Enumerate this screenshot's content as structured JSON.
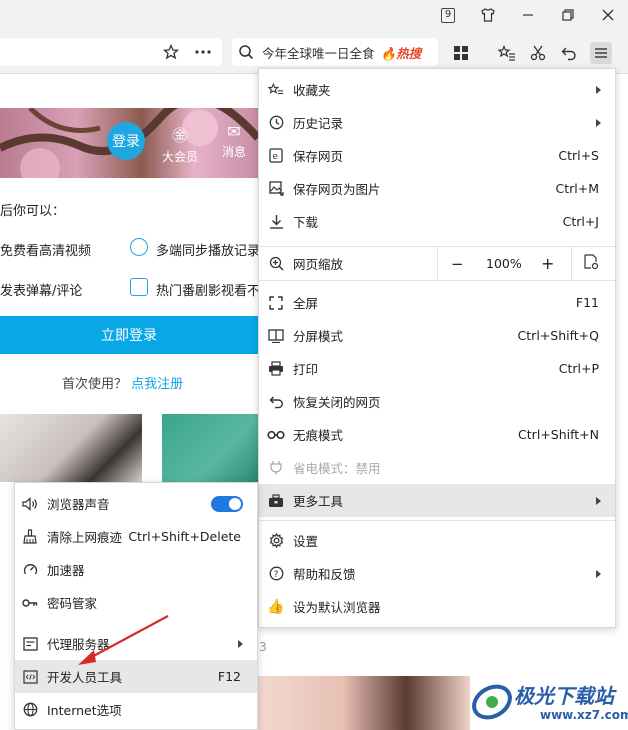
{
  "titlebar": {
    "badge_number": "9"
  },
  "toolbar": {
    "search_text": "今年全球唯一日全食",
    "hot_label": "热搜"
  },
  "page": {
    "login_circle": "登录",
    "vip_label": "大会员",
    "msg_label": "消息",
    "after_login": "后你可以：",
    "feature1": "免费看高清视频",
    "feature2": "多端同步播放记录",
    "feature3": "发表弹幕/评论",
    "feature4": "热门番剧影视看不",
    "login_button": "立即登录",
    "first_use": "首次使用？",
    "register_link": "点我注册",
    "page_num": "3"
  },
  "menu": {
    "items": [
      {
        "label": "收藏夹",
        "shortcut": ""
      },
      {
        "label": "历史记录",
        "shortcut": ""
      },
      {
        "label": "保存网页",
        "shortcut": "Ctrl+S"
      },
      {
        "label": "保存网页为图片",
        "shortcut": "Ctrl+M"
      },
      {
        "label": "下载",
        "shortcut": "Ctrl+J"
      },
      {
        "label": "网页缩放",
        "shortcut": ""
      },
      {
        "label": "全屏",
        "shortcut": "F11"
      },
      {
        "label": "分屏模式",
        "shortcut": "Ctrl+Shift+Q"
      },
      {
        "label": "打印",
        "shortcut": "Ctrl+P"
      },
      {
        "label": "恢复关闭的网页",
        "shortcut": ""
      },
      {
        "label": "无痕模式",
        "shortcut": "Ctrl+Shift+N"
      },
      {
        "label": "省电模式：禁用",
        "shortcut": ""
      },
      {
        "label": "更多工具",
        "shortcut": ""
      },
      {
        "label": "设置",
        "shortcut": ""
      },
      {
        "label": "帮助和反馈",
        "shortcut": ""
      },
      {
        "label": "设为默认浏览器",
        "shortcut": ""
      }
    ],
    "zoom": {
      "minus": "−",
      "value": "100%",
      "plus": "+"
    }
  },
  "submenu": {
    "items": [
      {
        "label": "浏览器声音",
        "shortcut": ""
      },
      {
        "label": "清除上网痕迹",
        "shortcut": "Ctrl+Shift+Delete"
      },
      {
        "label": "加速器",
        "shortcut": ""
      },
      {
        "label": "密码管家",
        "shortcut": ""
      },
      {
        "label": "代理服务器",
        "shortcut": ""
      },
      {
        "label": "开发人员工具",
        "shortcut": "F12"
      },
      {
        "label": "Internet选项",
        "shortcut": ""
      }
    ],
    "sound_enabled": true
  },
  "watermark": {
    "text": "极光下载站",
    "url": "www.xz7.com"
  },
  "colors": {
    "accent": "#0aa7e6",
    "toggle": "#1f7ae0",
    "hot": "#e84a2a",
    "arrow": "#d62b2b"
  }
}
